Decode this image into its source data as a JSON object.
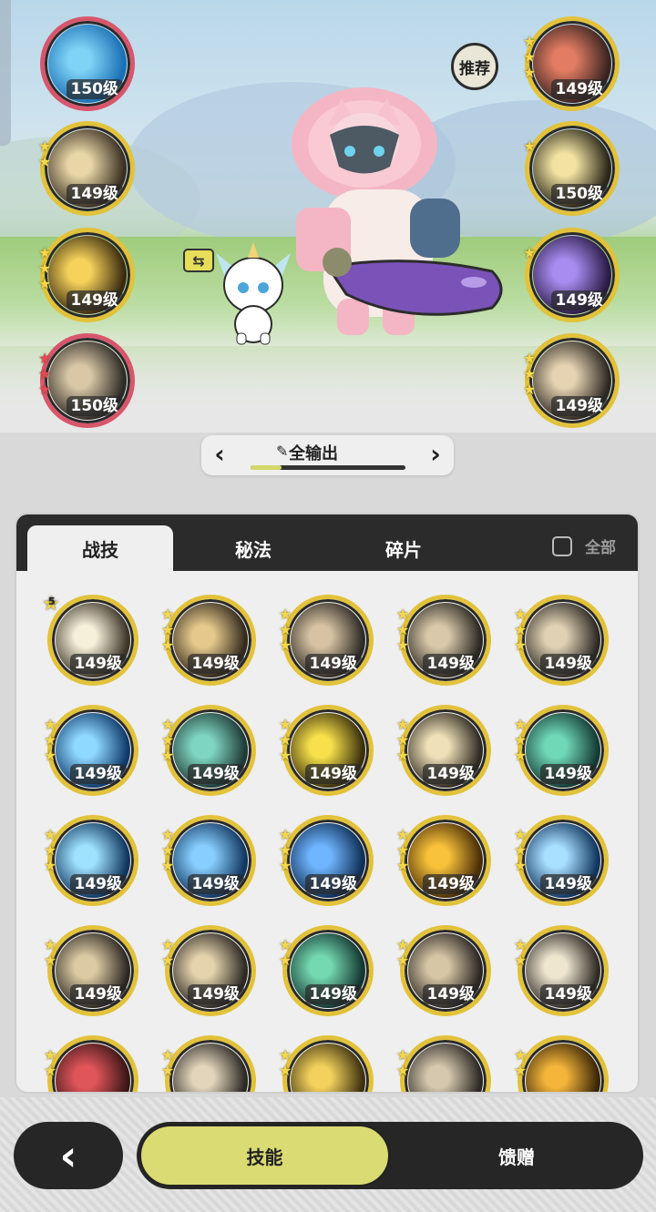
{
  "colors": {
    "gold_ring": "#e2c23a",
    "red_ring": "#d8566c",
    "accent_lime": "#dadb72",
    "dark": "#262626"
  },
  "scene": {
    "recommend_label": "推荐",
    "swap_icon": "swap-arrows-icon",
    "left_slots": [
      {
        "level": "150级",
        "stars": 0,
        "star_color": "gold",
        "ring": "red",
        "icon": "blue-wave-icon"
      },
      {
        "level": "149级",
        "stars": 2,
        "star_color": "gold",
        "ring": "gold",
        "icon": "scroll-icon"
      },
      {
        "level": "149级",
        "stars": 3,
        "star_color": "gold",
        "ring": "gold",
        "icon": "golden-slash-icon"
      },
      {
        "level": "150级",
        "stars": 3,
        "star_color": "red",
        "ring": "red",
        "icon": "wind-slash-icon"
      }
    ],
    "right_slots": [
      {
        "level": "149级",
        "stars": 3,
        "star_color": "gold",
        "ring": "gold",
        "icon": "shield-sword-icon"
      },
      {
        "level": "150级",
        "stars": 1,
        "star_color": "gold",
        "ring": "gold",
        "icon": "eye-icon"
      },
      {
        "level": "149级",
        "stars": 1,
        "star_color": "gold",
        "ring": "gold",
        "icon": "purple-dragon-icon"
      },
      {
        "level": "149级",
        "stars": 3,
        "star_color": "gold",
        "ring": "gold",
        "icon": "sword-up-icon"
      }
    ]
  },
  "build": {
    "name": "全输出",
    "prev_icon": "chevron-left-icon",
    "next_icon": "chevron-right-icon",
    "progress": 0.2
  },
  "tabs": [
    {
      "label": "战技",
      "active": true
    },
    {
      "label": "秘法",
      "active": false
    },
    {
      "label": "碎片",
      "active": false
    }
  ],
  "all_label": "全部",
  "grid": [
    {
      "level": "149级",
      "stars": 0,
      "badge": "5",
      "hue": "burst-white"
    },
    {
      "level": "149级",
      "stars": 3,
      "hue": "sword-gold"
    },
    {
      "level": "149级",
      "stars": 3,
      "hue": "spikes-beige"
    },
    {
      "level": "149级",
      "stars": 3,
      "hue": "claw-beige"
    },
    {
      "level": "149级",
      "stars": 3,
      "hue": "strike-beige"
    },
    {
      "level": "149级",
      "stars": 3,
      "hue": "ice-blue"
    },
    {
      "level": "149级",
      "stars": 3,
      "hue": "web-teal"
    },
    {
      "level": "149级",
      "stars": 3,
      "hue": "gem-yellow"
    },
    {
      "level": "149级",
      "stars": 3,
      "hue": "spark-beige"
    },
    {
      "level": "149级",
      "stars": 3,
      "hue": "sword-teal"
    },
    {
      "level": "149级",
      "stars": 3,
      "hue": "crystal-blue"
    },
    {
      "level": "149级",
      "stars": 3,
      "hue": "ring-blue"
    },
    {
      "level": "149级",
      "stars": 3,
      "hue": "orb-blue"
    },
    {
      "level": "149级",
      "stars": 3,
      "hue": "explosion-gold"
    },
    {
      "level": "149级",
      "stars": 3,
      "hue": "star-blue"
    },
    {
      "level": "149级",
      "stars": 2,
      "hue": "arc-beige"
    },
    {
      "level": "149级",
      "stars": 2,
      "hue": "stars-beige"
    },
    {
      "level": "149级",
      "stars": 2,
      "hue": "slash-teal"
    },
    {
      "level": "149级",
      "stars": 2,
      "hue": "swirl-beige"
    },
    {
      "level": "149级",
      "stars": 2,
      "hue": "fist-beige"
    },
    {
      "level": "",
      "stars": 2,
      "hue": "red-sword"
    },
    {
      "level": "",
      "stars": 2,
      "hue": "stones-beige"
    },
    {
      "level": "",
      "stars": 2,
      "hue": "diamond-gold"
    },
    {
      "level": "",
      "stars": 2,
      "hue": "dust-beige"
    },
    {
      "level": "",
      "stars": 2,
      "hue": "flame-gold"
    }
  ],
  "bottom": {
    "back_icon": "chevron-left-icon",
    "tab_skill": "技能",
    "tab_gift": "馈赠"
  }
}
